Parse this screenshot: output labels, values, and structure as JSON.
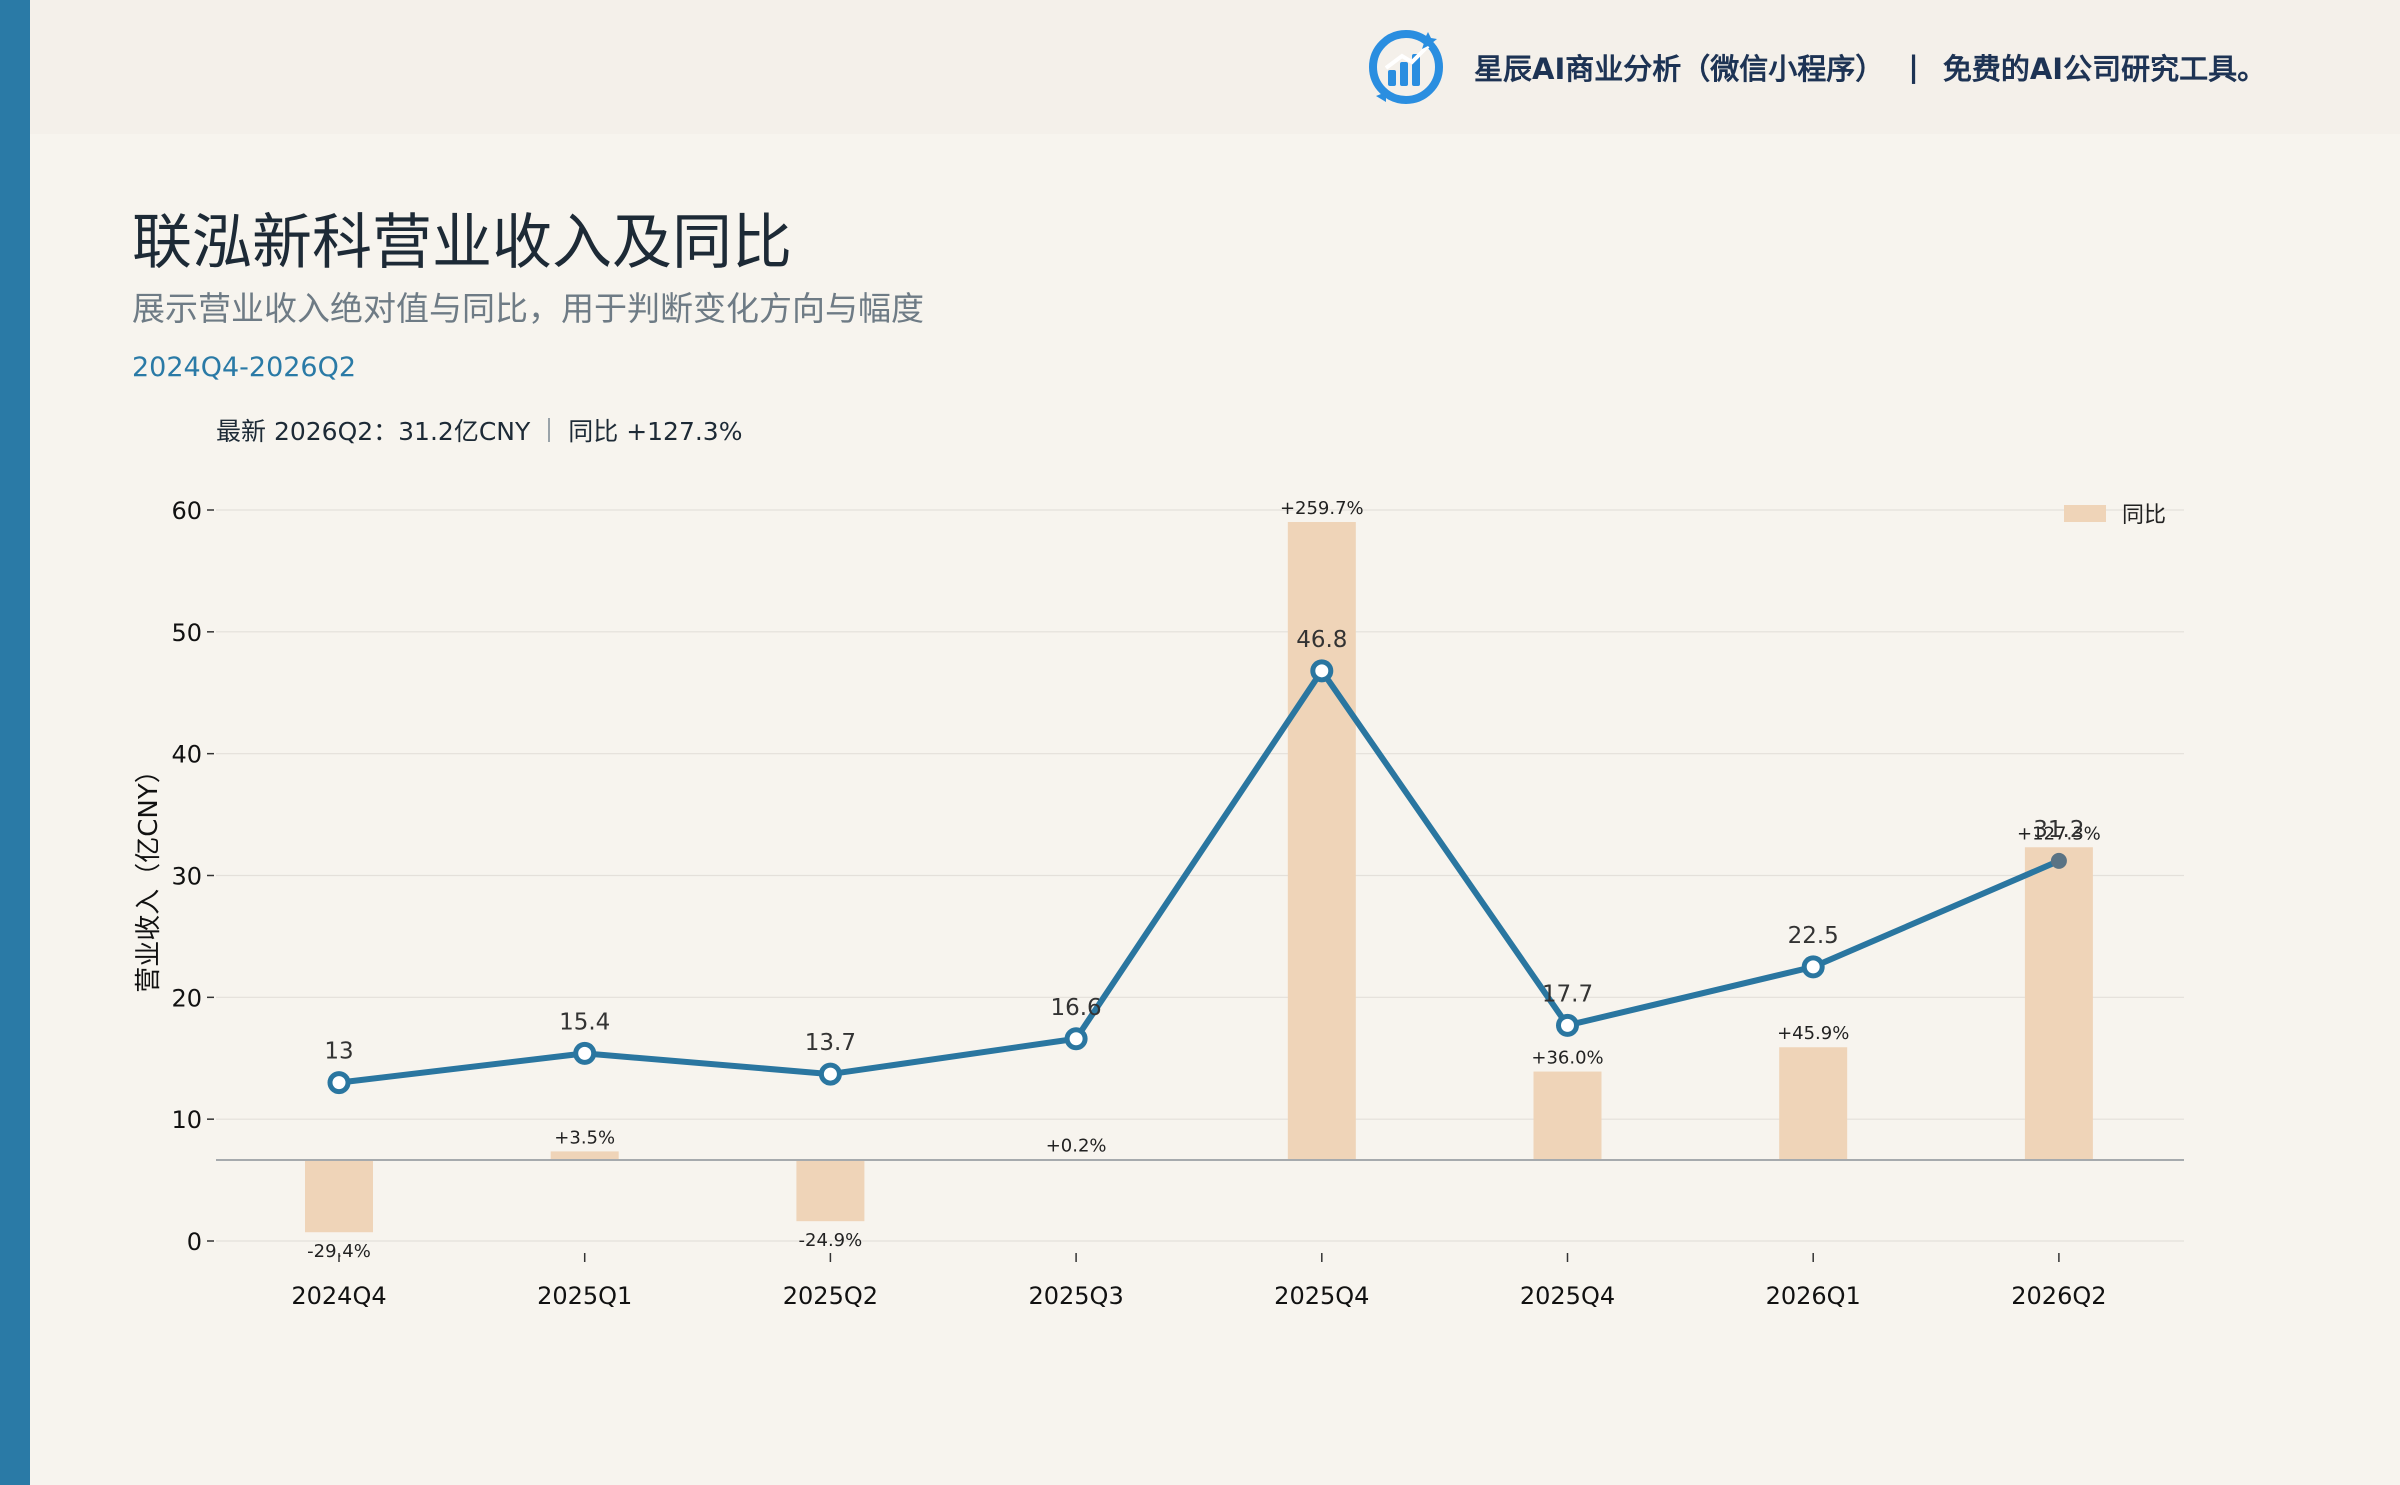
{
  "header": {
    "brand_name": "星辰AI商业分析（微信小程序）",
    "separator": "|",
    "tagline": "免费的AI公司研究工具。",
    "logo_icon": "bar-chart-logo-icon"
  },
  "title": "联泓新科营业收入及同比",
  "subtitle": "展示营业收入绝对值与同比，用于判断变化方向与幅度",
  "period": "2024Q4-2026Q2",
  "latest": {
    "label": "最新 2026Q2：31.2亿CNY",
    "yoy": "同比 +127.3%"
  },
  "colors": {
    "line": "#2a76a0",
    "bar": "#efd4b8",
    "accent": "#2a7aa6",
    "last_point": "#5a7384"
  },
  "chart_data": {
    "type": "bar+line",
    "categories": [
      "2024Q4",
      "2025Q1",
      "2025Q2",
      "2025Q3",
      "2025Q4",
      "2025Q4",
      "2026Q1",
      "2026Q2"
    ],
    "ylabel": "营业收入（亿CNY）",
    "ylim": [
      0,
      60
    ],
    "yticks": [
      "0",
      "10",
      "20",
      "30",
      "40",
      "50",
      "60"
    ],
    "grid": true,
    "legend": {
      "position": "top-right",
      "entries": [
        "同比"
      ]
    },
    "series": [
      {
        "name": "营业收入",
        "kind": "line",
        "values": [
          13.0,
          15.4,
          13.7,
          16.6,
          46.8,
          17.7,
          22.5,
          31.2
        ],
        "labels": [
          "13",
          "15.4",
          "13.7",
          "16.6",
          "46.8",
          "17.7",
          "22.5",
          "31.2"
        ]
      },
      {
        "name": "同比",
        "kind": "bar",
        "values": [
          -29.4,
          3.5,
          -24.9,
          0.2,
          259.7,
          36.0,
          45.9,
          127.3
        ],
        "labels": [
          "-29.4%",
          "+3.5%",
          "-24.9%",
          "+0.2%",
          "+259.7%",
          "+36.0%",
          "+45.9%",
          "+127.3%"
        ]
      }
    ]
  }
}
